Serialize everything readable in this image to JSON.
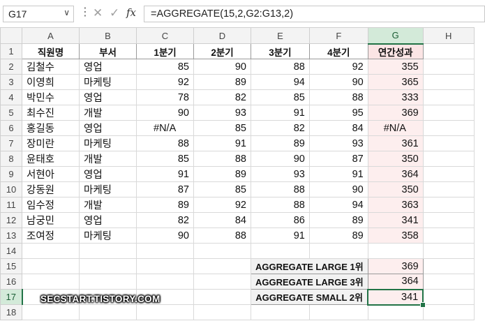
{
  "formula_bar": {
    "name_box": "G17",
    "name_box_arrow": "∨",
    "cancel_icon": "✕",
    "enter_icon": "✓",
    "fx_label": "fx",
    "formula": "=AGGREGATE(15,2,G2:G13,2)"
  },
  "columns": [
    "A",
    "B",
    "C",
    "D",
    "E",
    "F",
    "G",
    "H"
  ],
  "rows": [
    "1",
    "2",
    "3",
    "4",
    "5",
    "6",
    "7",
    "8",
    "9",
    "10",
    "11",
    "12",
    "13",
    "14",
    "15",
    "16",
    "17",
    "18"
  ],
  "table": {
    "headers": [
      "직원명",
      "부서",
      "1분기",
      "2분기",
      "3분기",
      "4분기",
      "연간성과"
    ],
    "data": [
      [
        "김철수",
        "영업",
        "85",
        "90",
        "88",
        "92",
        "355"
      ],
      [
        "이영희",
        "마케팅",
        "92",
        "89",
        "94",
        "90",
        "365"
      ],
      [
        "박민수",
        "영업",
        "78",
        "82",
        "85",
        "88",
        "333"
      ],
      [
        "최수진",
        "개발",
        "90",
        "93",
        "91",
        "95",
        "369"
      ],
      [
        "홍길동",
        "영업",
        "#N/A",
        "85",
        "82",
        "84",
        "#N/A"
      ],
      [
        "장미란",
        "마케팅",
        "88",
        "91",
        "89",
        "93",
        "361"
      ],
      [
        "윤태호",
        "개발",
        "85",
        "88",
        "90",
        "87",
        "350"
      ],
      [
        "서현아",
        "영업",
        "91",
        "89",
        "93",
        "91",
        "364"
      ],
      [
        "강동원",
        "마케팅",
        "87",
        "85",
        "88",
        "90",
        "350"
      ],
      [
        "임수정",
        "개발",
        "89",
        "92",
        "88",
        "94",
        "363"
      ],
      [
        "남궁민",
        "영업",
        "82",
        "84",
        "86",
        "89",
        "341"
      ],
      [
        "조여정",
        "마케팅",
        "90",
        "88",
        "91",
        "89",
        "358"
      ]
    ]
  },
  "summary": [
    {
      "label": "AGGREGATE LARGE 1위",
      "value": "369"
    },
    {
      "label": "AGGREGATE LARGE 3위",
      "value": "364"
    },
    {
      "label": "AGGREGATE SMALL 2위",
      "value": "341"
    }
  ],
  "watermark": "SECSTART.TISTORY.COM",
  "colors": {
    "selection": "#217346",
    "pink_fill": "#fdeeee",
    "header_bg": "#f3f3f3"
  }
}
